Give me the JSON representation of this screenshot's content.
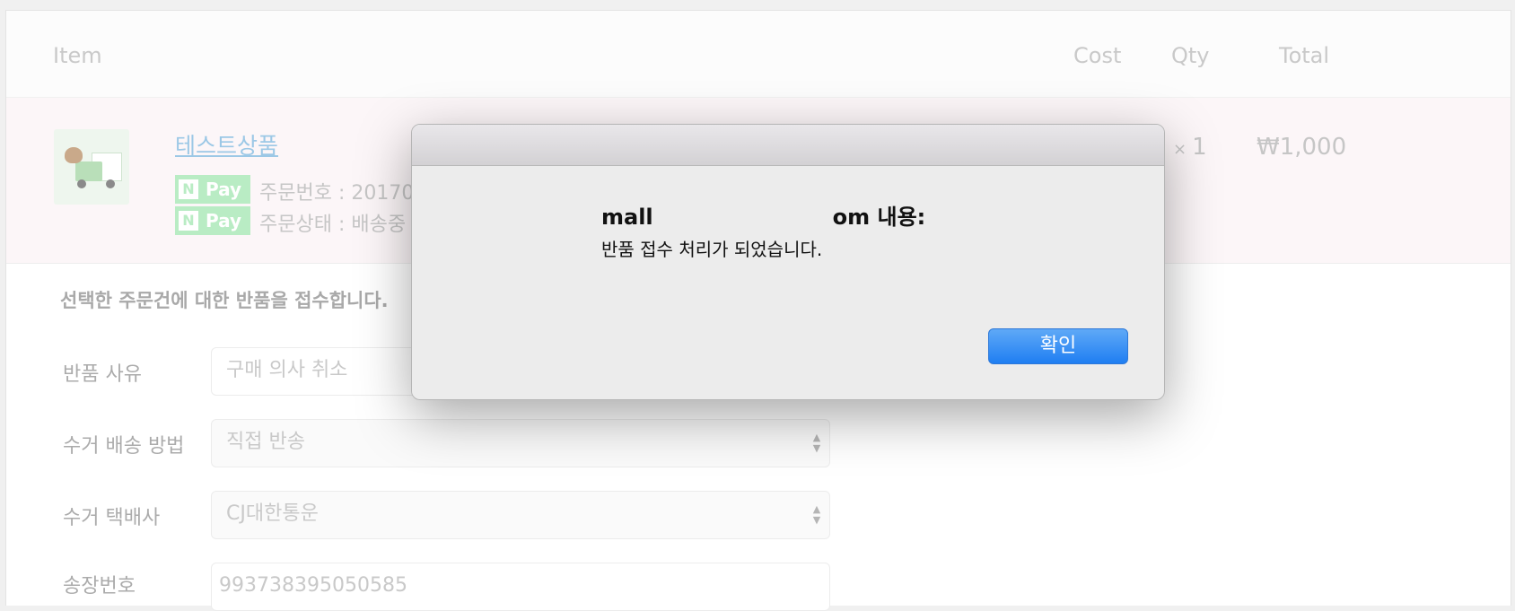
{
  "table_header": {
    "item": "Item",
    "cost": "Cost",
    "qty": "Qty",
    "total": "Total"
  },
  "order_item": {
    "product_name": "테스트상품",
    "npay_label": "Pay",
    "npay_letter": "N",
    "order_number_text": "주문번호 : 20170",
    "order_status_text": "주문상태 : 배송중",
    "qty_symbol": "×",
    "qty_value": "1",
    "total": "₩1,000"
  },
  "return_form": {
    "notice": "선택한 주문건에 대한 반품을 접수합니다.",
    "reason_label": "반품 사유",
    "reason_value": "구매 의사 취소",
    "method_label": "수거 배송 방법",
    "method_value": "직접 반송",
    "courier_label": "수거 택배사",
    "courier_value": "CJ대한통운",
    "invoice_label": "송장번호",
    "invoice_value": "993738395050585"
  },
  "alert": {
    "title_prefix": "mall",
    "title_suffix": "om 내용:",
    "message": "반품 접수 처리가 되었습니다.",
    "ok_label": "확인"
  }
}
